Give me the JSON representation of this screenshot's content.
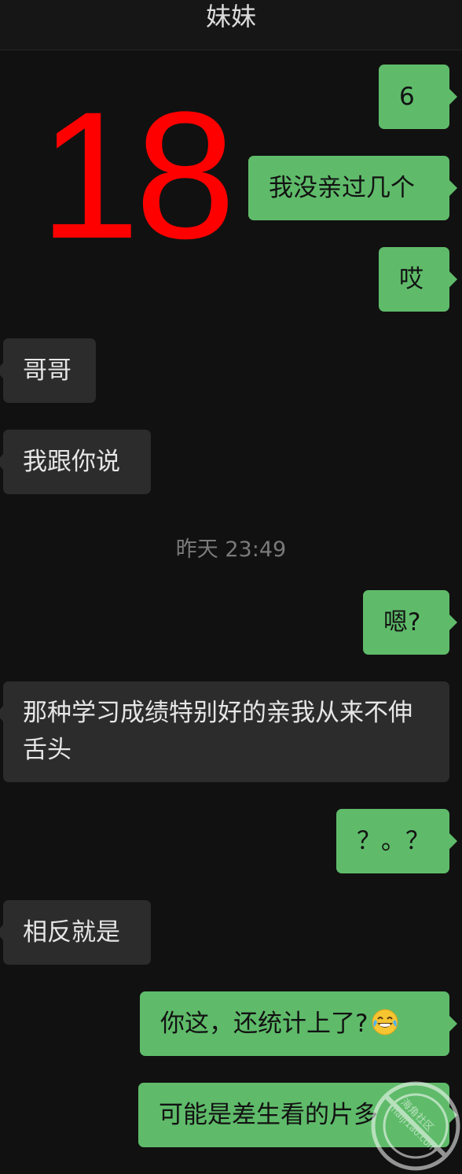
{
  "header": {
    "title": "妹妹"
  },
  "overlay": {
    "number": "18"
  },
  "messages": [
    {
      "side": "out",
      "text": "6"
    },
    {
      "side": "out",
      "text": "我没亲过几个"
    },
    {
      "side": "out",
      "text": "哎"
    },
    {
      "side": "in",
      "text": "哥哥"
    },
    {
      "side": "in",
      "text": "我跟你说"
    },
    {
      "side": "out",
      "text": "嗯?"
    },
    {
      "side": "in",
      "text": "那种学习成绩特别好的亲我从来不伸舌头"
    },
    {
      "side": "out",
      "text": "？。？"
    },
    {
      "side": "in",
      "text": "相反就是"
    },
    {
      "side": "out",
      "text": "你这，还统计上了?",
      "emoji": "face-with-tears-of-joy"
    },
    {
      "side": "out",
      "text": "可能是差生看的片多"
    }
  ],
  "timestamp": "昨天 23:49",
  "watermark": {
    "text": "haiji1ao.com",
    "subtext": "海角社区"
  },
  "colors": {
    "outgoing_bubble": "#5fbb6a",
    "incoming_bubble": "#2c2c2c",
    "background": "#111111",
    "overlay_number": "#ff0000"
  }
}
